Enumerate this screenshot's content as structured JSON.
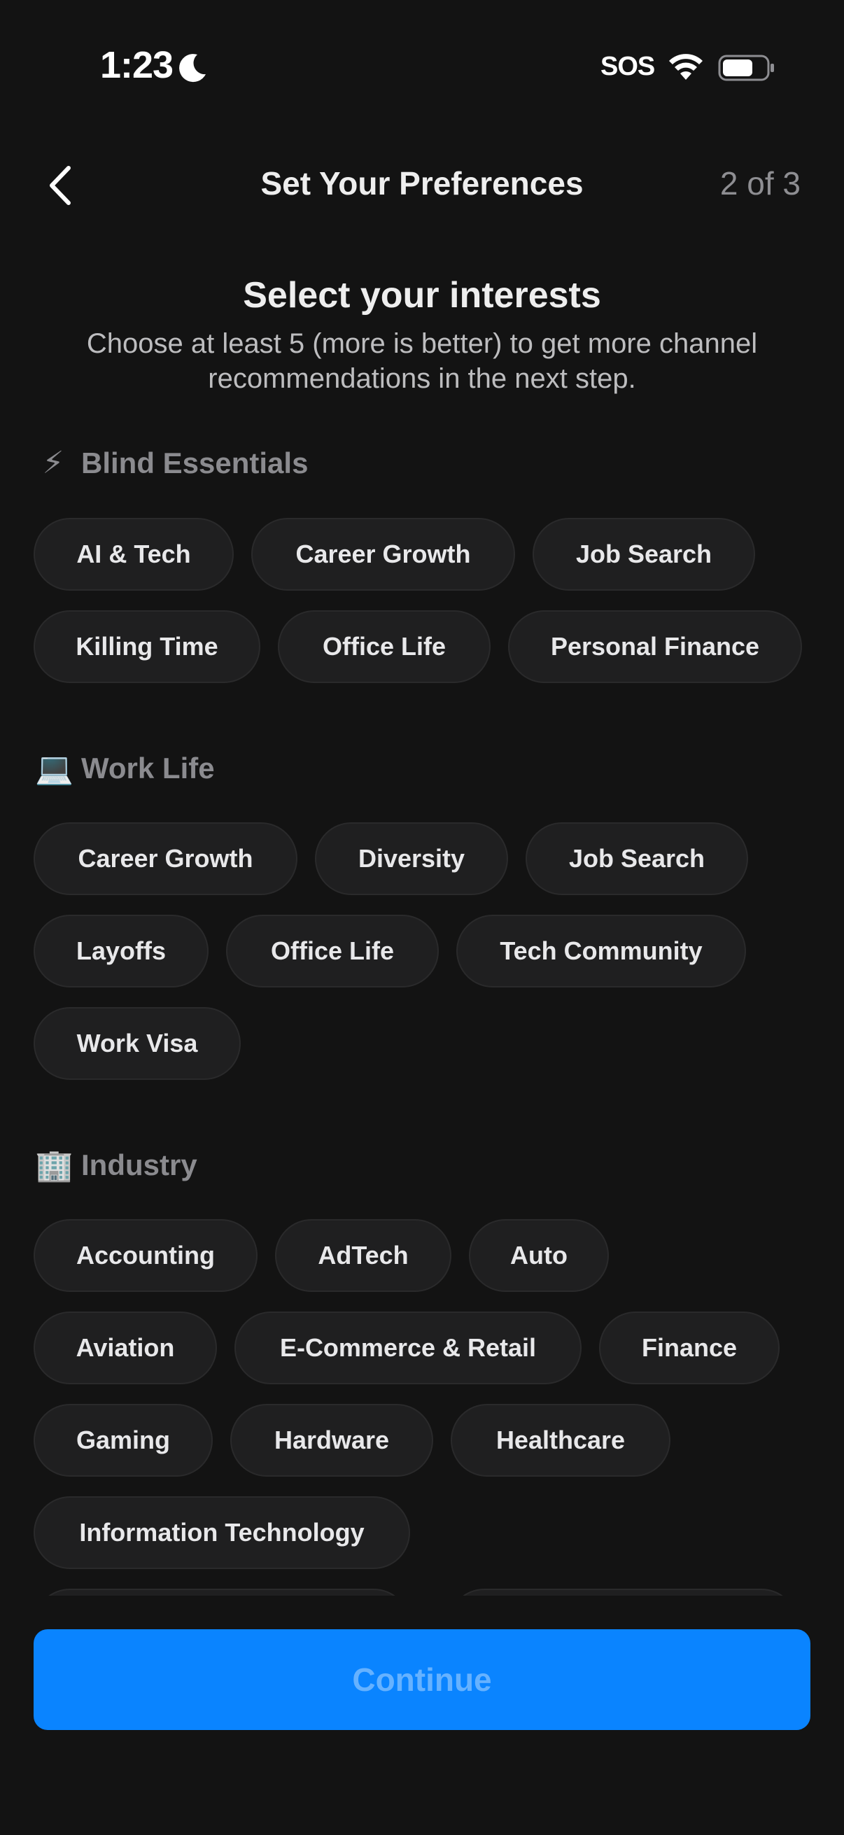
{
  "status_bar": {
    "time": "1:23",
    "sos": "SOS"
  },
  "header": {
    "title": "Set Your Preferences",
    "step": "2 of 3"
  },
  "intro": {
    "headline": "Select your interests",
    "subtitle": "Choose at least 5 (more is better) to get more channel recommendations in the next step."
  },
  "sections": [
    {
      "emoji": "⚡",
      "title": "Blind Essentials",
      "chips": [
        "AI & Tech",
        "Career Growth",
        "Job Search",
        "Killing Time",
        "Office Life",
        "Personal Finance"
      ]
    },
    {
      "emoji": "💻",
      "title": "Work Life",
      "chips": [
        "Career Growth",
        "Diversity",
        "Job Search",
        "Layoffs",
        "Office Life",
        "Tech Community",
        "Work Visa"
      ]
    },
    {
      "emoji": "🏢",
      "title": "Industry",
      "chips": [
        "Accounting",
        "AdTech",
        "Auto",
        "Aviation",
        "E-Commerce & Retail",
        "Finance",
        "Gaming",
        "Hardware",
        "Healthcare",
        "Information Technology"
      ]
    }
  ],
  "footer": {
    "continue_label": "Continue"
  },
  "colors": {
    "background": "#131313",
    "accent": "#0a84ff",
    "chip": "#1f1f20"
  }
}
